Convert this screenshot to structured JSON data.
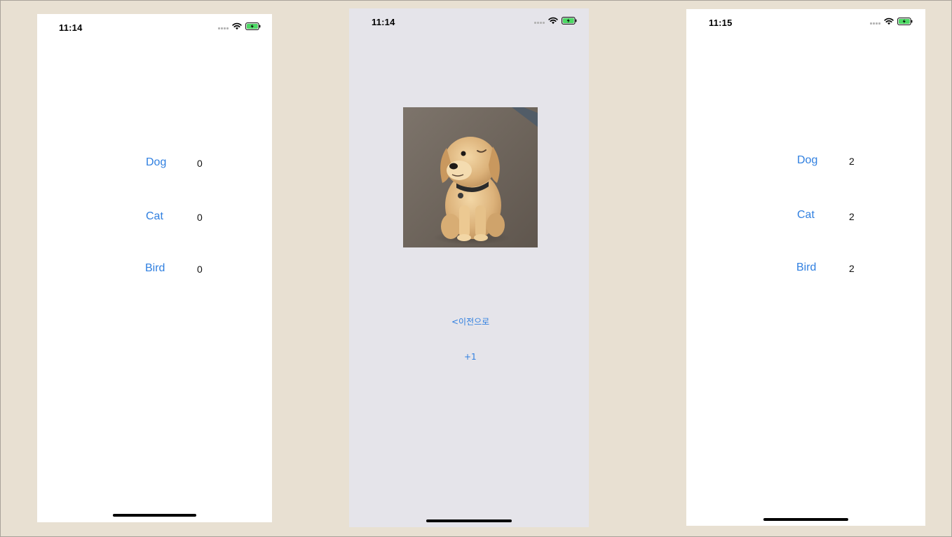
{
  "colors": {
    "background": "#e8e0d2",
    "link_blue": "#2f7fe0",
    "detail_background": "#e5e4ea",
    "battery_green": "#4cd964"
  },
  "screens": [
    {
      "status_time": "11:14",
      "rows": [
        {
          "label": "Dog",
          "count": "0"
        },
        {
          "label": "Cat",
          "count": "0"
        },
        {
          "label": "Bird",
          "count": "0"
        }
      ]
    },
    {
      "status_time": "11:14",
      "image": "golden-retriever-puppy-photo",
      "back_label": "<이전으로",
      "increment_label": "+1"
    },
    {
      "status_time": "11:15",
      "rows": [
        {
          "label": "Dog",
          "count": "2"
        },
        {
          "label": "Cat",
          "count": "2"
        },
        {
          "label": "Bird",
          "count": "2"
        }
      ]
    }
  ],
  "icons": [
    "cellular-signal-icon",
    "wifi-icon",
    "battery-charging-icon"
  ]
}
